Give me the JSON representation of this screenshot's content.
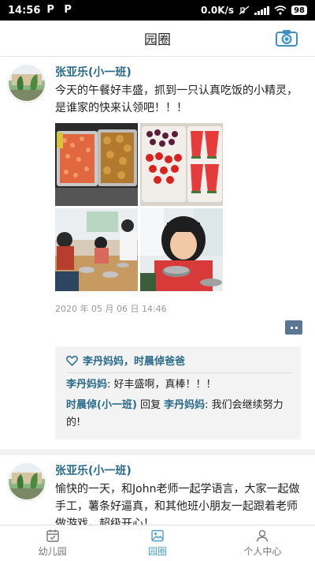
{
  "status_bar": {
    "time": "14:56",
    "app_icons": [
      "P",
      "P"
    ],
    "net_speed": "0.0K/s",
    "battery": "98"
  },
  "header": {
    "title": "园圈",
    "camera_icon": "camera-icon"
  },
  "posts": [
    {
      "author": "张亚乐(小一班)",
      "content": "今天的午餐好丰盛，抓到一只认真吃饭的小精灵，是谁家的快来认领吧！！！",
      "timestamp": "2020 年 05 月 06 日 14:46",
      "likes": "李丹妈妈，时晨倬爸爸",
      "comments": [
        {
          "name": "李丹妈妈",
          "text": ": 好丰盛啊，真棒！！！"
        },
        {
          "name": "时晨倬(小一班)",
          "reply_word": " 回复 ",
          "reply_to": "李丹妈妈",
          "text": ": 我们会继续努力的!"
        }
      ]
    },
    {
      "author": "张亚乐(小一班)",
      "content": "愉快的一天，和John老师一起学语言，大家一起做手工，薯条好逼真，和其他班小朋友一起跟着老师做游戏，超级开心！"
    }
  ],
  "tabbar": {
    "tabs": [
      {
        "label": "幼儿园",
        "icon": "calendar-icon"
      },
      {
        "label": "园圈",
        "icon": "photo-icon",
        "active": true
      },
      {
        "label": "个人中心",
        "icon": "person-icon"
      }
    ]
  },
  "colors": {
    "accent": "#4aa0c8",
    "name_blue": "#2a6b8a",
    "comment_box": "#f3f3f3"
  }
}
